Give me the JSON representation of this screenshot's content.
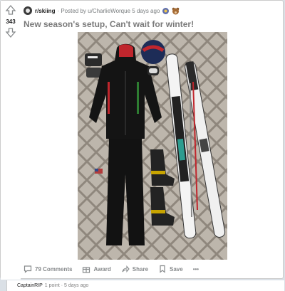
{
  "post": {
    "subreddit": "r/skiing",
    "posted_by": "· Posted by u/CharlieWorque",
    "age": "5 days ago",
    "score": "343",
    "title": "New season's setup, Can't wait for winter!"
  },
  "actions": {
    "comments": "79 Comments",
    "award": "Award",
    "share": "Share",
    "save": "Save",
    "more": "•••"
  },
  "comment_preview": {
    "author": "CaptainRIP",
    "points": "1 point",
    "age": "· 5 days ago"
  },
  "icons": {
    "upvote": "arrow-up-icon",
    "downvote": "arrow-down-icon",
    "comments": "comment-bubble-icon",
    "award": "gift-icon",
    "share": "share-arrow-icon",
    "save": "bookmark-icon",
    "more": "ellipsis-icon"
  },
  "colors": {
    "page_bg": "#dae0e6",
    "card_bg": "#ffffff",
    "meta_text": "#787c7e",
    "title_text": "#7a7a7a"
  }
}
